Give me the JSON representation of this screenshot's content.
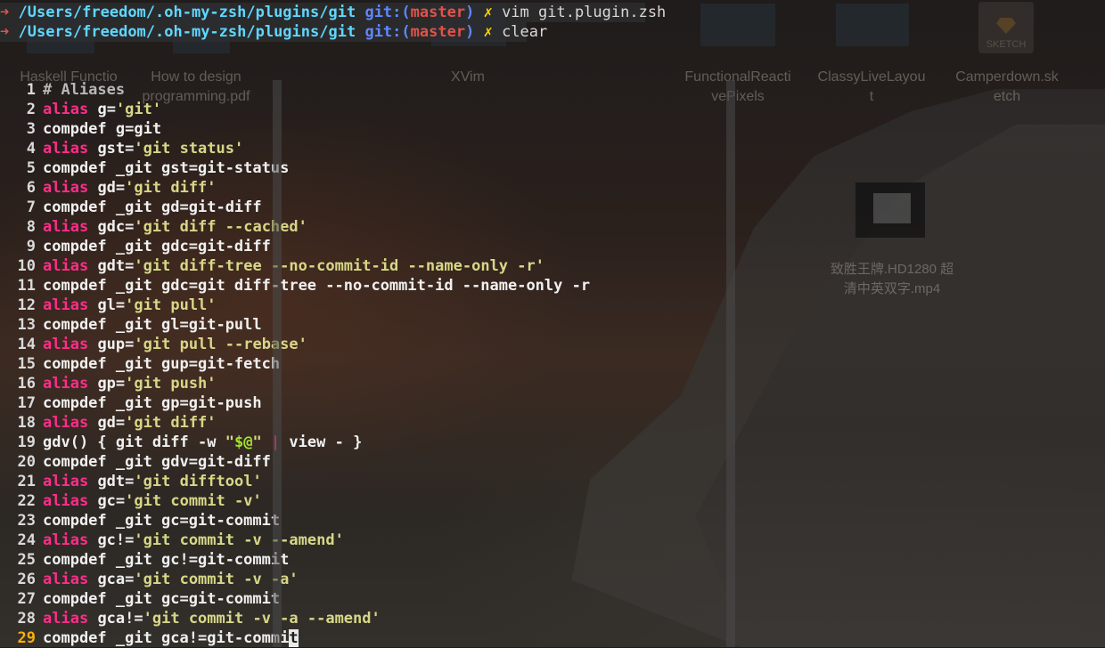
{
  "terminal": {
    "prompt_lines": [
      {
        "arrow": "➜",
        "path": "/Users/freedom/.oh-my-zsh/plugins/git",
        "git_label": "git:(",
        "branch": "master",
        "git_close": ")",
        "dirty": "✗",
        "command": "vim git.plugin.zsh"
      },
      {
        "arrow": "➜",
        "path": "/Users/freedom/.oh-my-zsh/plugins/git",
        "git_label": "git:(",
        "branch": "master",
        "git_close": ")",
        "dirty": "✗",
        "command": "clear"
      }
    ]
  },
  "desktop": {
    "icon_labels": [
      "Haskell Functio",
      "How to design",
      "XVim",
      "FunctionalReacti",
      "ClassyLiveLayou",
      "Camperdown.sk"
    ],
    "icon_labels_line2": [
      "",
      "programming.pdf",
      "",
      "vePixels",
      "t",
      "etch"
    ],
    "sketch_label": "SKETCH",
    "video_label": "致胜王牌.HD1280 超清中英双字.mp4"
  },
  "vim": {
    "current_line": 29,
    "cursor_char": "t",
    "lines": [
      {
        "n": "1",
        "code": "# Aliases",
        "type": "comment"
      },
      {
        "n": "2",
        "code": "g='git'",
        "type": "alias",
        "name": "g",
        "value": "'git'"
      },
      {
        "n": "3",
        "code": "compdef g=git",
        "type": "plain"
      },
      {
        "n": "4",
        "code": "gst='git status'",
        "type": "alias",
        "name": "gst",
        "value": "'git status'"
      },
      {
        "n": "5",
        "code": "compdef _git gst=git-status",
        "type": "plain"
      },
      {
        "n": "6",
        "code": "gd='git diff'",
        "type": "alias",
        "name": "gd",
        "value": "'git diff'"
      },
      {
        "n": "7",
        "code": "compdef _git gd=git-diff",
        "type": "plain"
      },
      {
        "n": "8",
        "code": "gdc='git diff --cached'",
        "type": "alias",
        "name": "gdc",
        "value": "'git diff --cached'"
      },
      {
        "n": "9",
        "code": "compdef _git gdc=git-diff",
        "type": "plain"
      },
      {
        "n": "10",
        "code": "gdt='git diff-tree --no-commit-id --name-only -r'",
        "type": "alias",
        "name": "gdt",
        "value": "'git diff-tree --no-commit-id --name-only -r'"
      },
      {
        "n": "11",
        "code": "compdef _git gdc=git diff-tree --no-commit-id --name-only -r",
        "type": "plain"
      },
      {
        "n": "12",
        "code": "gl='git pull'",
        "type": "alias",
        "name": "gl",
        "value": "'git pull'"
      },
      {
        "n": "13",
        "code": "compdef _git gl=git-pull",
        "type": "plain"
      },
      {
        "n": "14",
        "code": "gup='git pull --rebase'",
        "type": "alias",
        "name": "gup",
        "value": "'git pull --rebase'"
      },
      {
        "n": "15",
        "code": "compdef _git gup=git-fetch",
        "type": "plain"
      },
      {
        "n": "16",
        "code": "gp='git push'",
        "type": "alias",
        "name": "gp",
        "value": "'git push'"
      },
      {
        "n": "17",
        "code": "compdef _git gp=git-push",
        "type": "plain"
      },
      {
        "n": "18",
        "code": "gd='git diff'",
        "type": "alias",
        "name": "gd",
        "value": "'git diff'"
      },
      {
        "n": "19",
        "code": "gdv() { git diff -w \"$@\" | view - }",
        "type": "func"
      },
      {
        "n": "20",
        "code": "compdef _git gdv=git-diff",
        "type": "plain"
      },
      {
        "n": "21",
        "code": "gdt='git difftool'",
        "type": "alias",
        "name": "gdt",
        "value": "'git difftool'"
      },
      {
        "n": "22",
        "code": "gc='git commit -v'",
        "type": "alias",
        "name": "gc",
        "value": "'git commit -v'"
      },
      {
        "n": "23",
        "code": "compdef _git gc=git-commit",
        "type": "plain"
      },
      {
        "n": "24",
        "code": "gc!='git commit -v --amend'",
        "type": "alias",
        "name": "gc!",
        "value": "'git commit -v --amend'"
      },
      {
        "n": "25",
        "code": "compdef _git gc!=git-commit",
        "type": "plain"
      },
      {
        "n": "26",
        "code": "gca='git commit -v -a'",
        "type": "alias",
        "name": "gca",
        "value": "'git commit -v -a'"
      },
      {
        "n": "27",
        "code": "compdef _git gc=git-commit",
        "type": "plain"
      },
      {
        "n": "28",
        "code": "gca!='git commit -v -a --amend'",
        "type": "alias",
        "name": "gca!",
        "value": "'git commit -v -a --amend'"
      },
      {
        "n": "29",
        "code": "compdef _git gca!=git-commit",
        "type": "plain"
      }
    ],
    "alias_keyword": "alias",
    "func_parts": {
      "head": "gdv() { git diff -w ",
      "q1": "\"",
      "var": "$@",
      "q2": "\"",
      "sp": " ",
      "pipe": "|",
      "tail": " view - }"
    }
  },
  "colors": {
    "keyword": "#ff2d8a",
    "string": "#d7d787",
    "path": "#5fd7ff",
    "git_label": "#5f87ff",
    "branch": "#e0524a",
    "dirty": "#ffd700",
    "current_line_number": "#ffb000"
  }
}
